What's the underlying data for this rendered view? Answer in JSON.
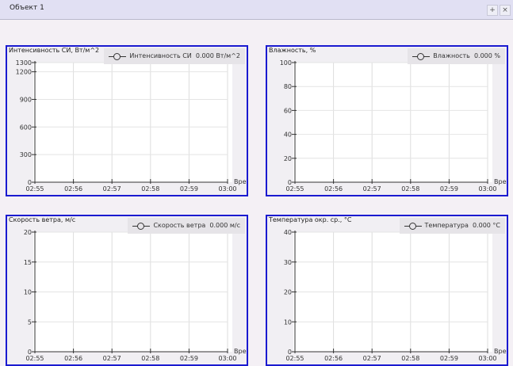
{
  "window": {
    "title": "Объект 1",
    "pin_icon": "pin-icon",
    "close_icon": "close-icon",
    "pin_label": "+",
    "close_label": "×"
  },
  "chart_data": [
    {
      "type": "line",
      "title": "Интенсивность СИ, Вт/м^2",
      "legend": {
        "name": "Интенсивность СИ",
        "value": "0.000 Вт/м^2"
      },
      "xlabel": "Время",
      "xticks": [
        "02:55",
        "02:56",
        "02:57",
        "02:58",
        "02:59",
        "03:00"
      ],
      "yticks": [
        0,
        300,
        600,
        900,
        1200,
        1300
      ],
      "ylim": [
        0,
        1300
      ],
      "series": []
    },
    {
      "type": "line",
      "title": "Влажность, %",
      "legend": {
        "name": "Влажность",
        "value": "0.000 %"
      },
      "xlabel": "Время",
      "xticks": [
        "02:55",
        "02:56",
        "02:57",
        "02:58",
        "02:59",
        "03:00"
      ],
      "yticks": [
        0,
        20,
        40,
        60,
        80,
        100
      ],
      "ylim": [
        0,
        100
      ],
      "series": []
    },
    {
      "type": "line",
      "title": "Скорость ветра, м/с",
      "legend": {
        "name": "Скорость ветра",
        "value": "0.000 м/с"
      },
      "xlabel": "Время",
      "xticks": [
        "02:55",
        "02:56",
        "02:57",
        "02:58",
        "02:59",
        "03:00"
      ],
      "yticks": [
        0,
        5,
        10,
        15,
        20
      ],
      "ylim": [
        0,
        20
      ],
      "series": []
    },
    {
      "type": "line",
      "title": "Температура окр. ср., °С",
      "legend": {
        "name": "Температура",
        "value": "0.000 °С"
      },
      "xlabel": "Время",
      "xticks": [
        "02:55",
        "02:56",
        "02:57",
        "02:58",
        "02:59",
        "03:00"
      ],
      "yticks": [
        0,
        10,
        20,
        30,
        40
      ],
      "ylim": [
        0,
        40
      ],
      "series": []
    }
  ]
}
